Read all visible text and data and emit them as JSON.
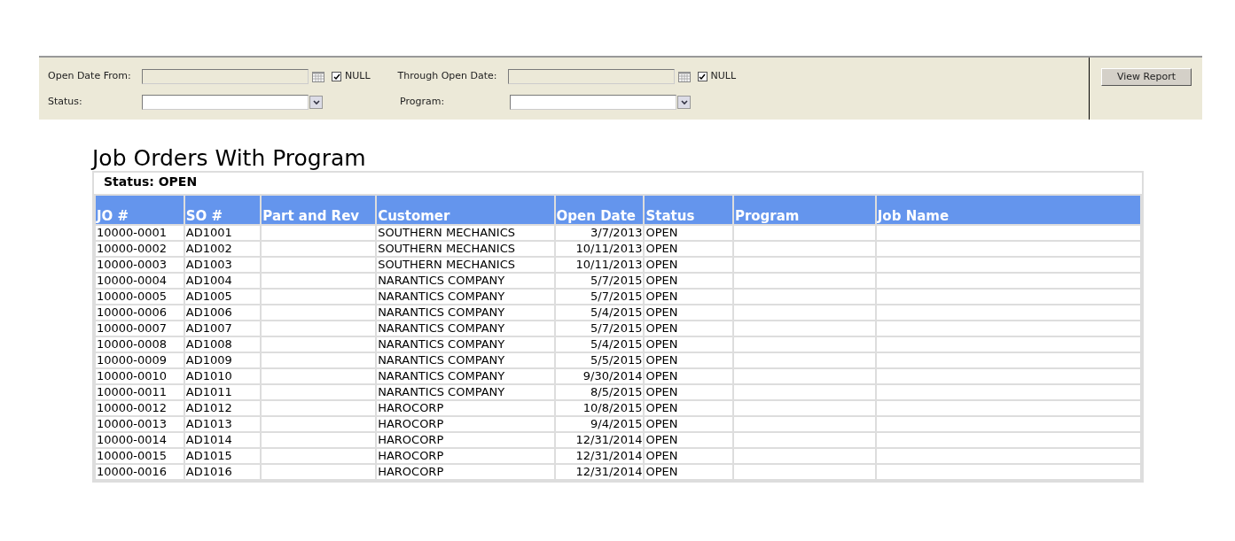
{
  "filters": {
    "open_date_from": {
      "label": "Open Date From:",
      "null_label": "NULL",
      "null_checked": true
    },
    "through_open_date": {
      "label": "Through Open Date:",
      "null_label": "NULL",
      "null_checked": true
    },
    "status": {
      "label": "Status:"
    },
    "program": {
      "label": "Program:"
    },
    "view_report_button": "View Report"
  },
  "report": {
    "title": "Job Orders With Program",
    "subtitle": "Status: OPEN",
    "columns": [
      "JO #",
      "SO #",
      "Part and Rev",
      "Customer",
      "Open Date",
      "Status",
      "Program",
      "Job Name"
    ],
    "rows": [
      [
        "10000-0001",
        "AD1001",
        "",
        "SOUTHERN MECHANICS",
        "3/7/2013",
        "OPEN",
        "",
        ""
      ],
      [
        "10000-0002",
        "AD1002",
        "",
        "SOUTHERN MECHANICS",
        "10/11/2013",
        "OPEN",
        "",
        ""
      ],
      [
        "10000-0003",
        "AD1003",
        "",
        "SOUTHERN MECHANICS",
        "10/11/2013",
        "OPEN",
        "",
        ""
      ],
      [
        "10000-0004",
        "AD1004",
        "",
        "NARANTICS COMPANY",
        "5/7/2015",
        "OPEN",
        "",
        ""
      ],
      [
        "10000-0005",
        "AD1005",
        "",
        "NARANTICS COMPANY",
        "5/7/2015",
        "OPEN",
        "",
        ""
      ],
      [
        "10000-0006",
        "AD1006",
        "",
        "NARANTICS COMPANY",
        "5/4/2015",
        "OPEN",
        "",
        ""
      ],
      [
        "10000-0007",
        "AD1007",
        "",
        "NARANTICS COMPANY",
        "5/7/2015",
        "OPEN",
        "",
        ""
      ],
      [
        "10000-0008",
        "AD1008",
        "",
        "NARANTICS COMPANY",
        "5/4/2015",
        "OPEN",
        "",
        ""
      ],
      [
        "10000-0009",
        "AD1009",
        "",
        "NARANTICS COMPANY",
        "5/5/2015",
        "OPEN",
        "",
        ""
      ],
      [
        "10000-0010",
        "AD1010",
        "",
        "NARANTICS COMPANY",
        "9/30/2014",
        "OPEN",
        "",
        ""
      ],
      [
        "10000-0011",
        "AD1011",
        "",
        "NARANTICS COMPANY",
        "8/5/2015",
        "OPEN",
        "",
        ""
      ],
      [
        "10000-0012",
        "AD1012",
        "",
        "HAROCORP",
        "10/8/2015",
        "OPEN",
        "",
        ""
      ],
      [
        "10000-0013",
        "AD1013",
        "",
        "HAROCORP",
        "9/4/2015",
        "OPEN",
        "",
        ""
      ],
      [
        "10000-0014",
        "AD1014",
        "",
        "HAROCORP",
        "12/31/2014",
        "OPEN",
        "",
        ""
      ],
      [
        "10000-0015",
        "AD1015",
        "",
        "HAROCORP",
        "12/31/2014",
        "OPEN",
        "",
        ""
      ],
      [
        "10000-0016",
        "AD1016",
        "",
        "HAROCORP",
        "12/31/2014",
        "OPEN",
        "",
        ""
      ]
    ]
  }
}
